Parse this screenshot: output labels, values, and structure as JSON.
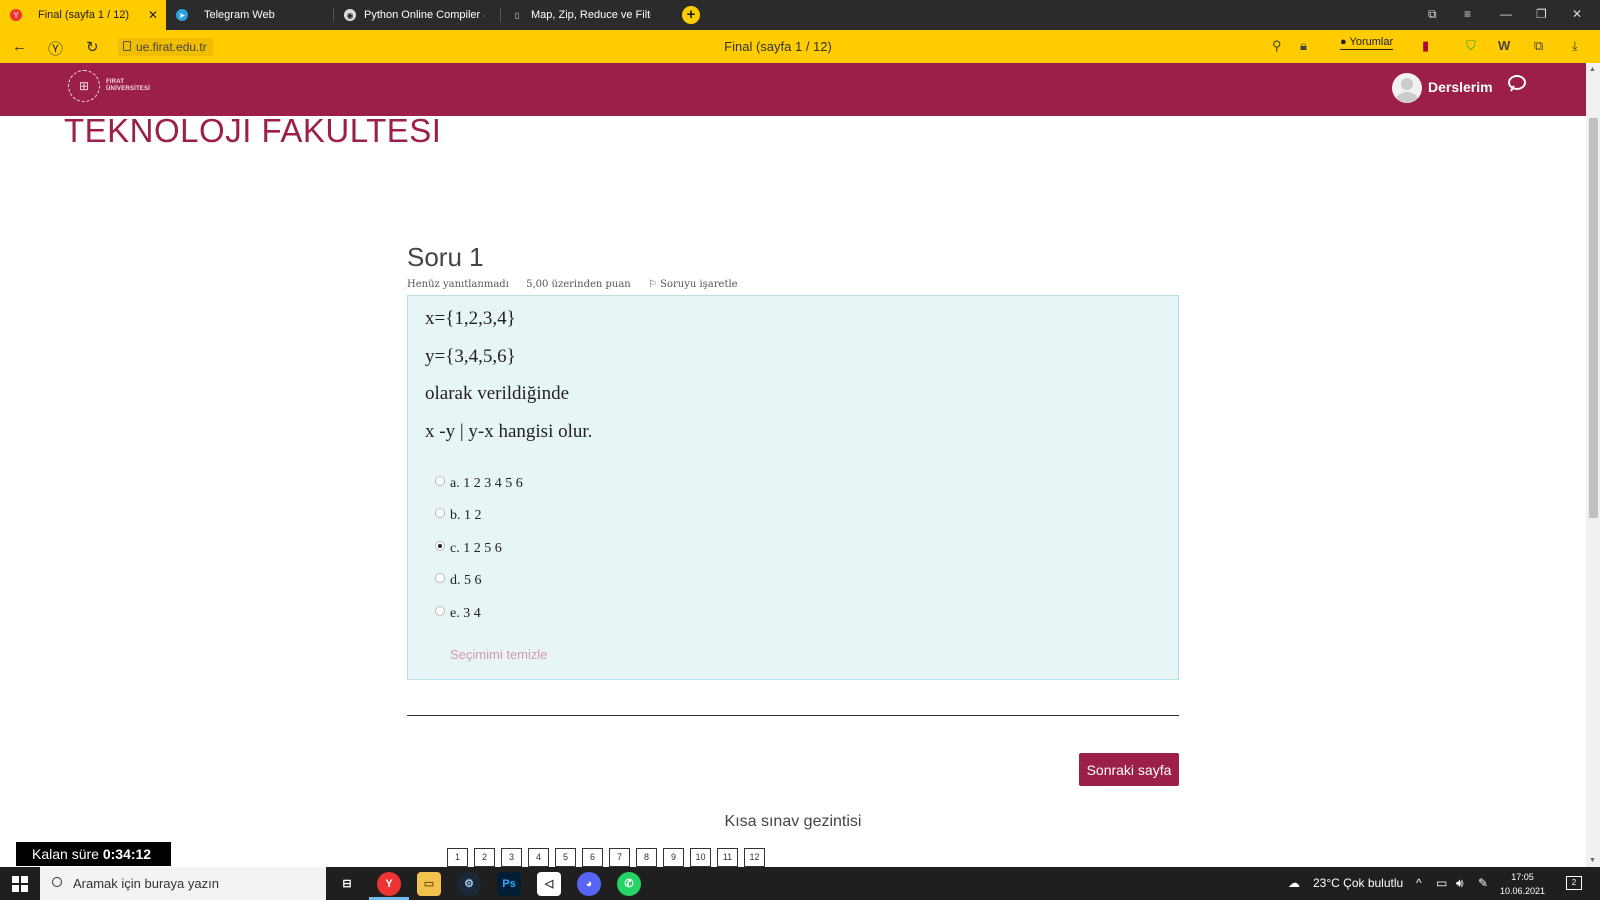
{
  "browser": {
    "tabs": [
      {
        "label": "Final (sayfa 1 / 12)",
        "active": true,
        "icon": "yandex-icon"
      },
      {
        "label": "Telegram Web",
        "active": false,
        "icon": "telegram-icon"
      },
      {
        "label": "Python Online Compiler &",
        "active": false,
        "icon": "compiler-icon"
      },
      {
        "label": "Map, Zip, Reduce ve Filter F",
        "active": false,
        "icon": "document-icon"
      }
    ],
    "url": "ue.firat.edu.tr",
    "page_title": "Final (sayfa 1 / 12)",
    "comments_label": "Yorumlar"
  },
  "site": {
    "logo_line1": "FIRAT",
    "logo_line2": "ÜNİVERSİTESİ",
    "user_menu": "Derslerim",
    "faculty_heading": "TEKNOLOJI FAKULTESI",
    "brand_color": "#9c1f47"
  },
  "question": {
    "title": "Soru 1",
    "status": "Henüz yanıtlanmadı",
    "points": "5,00 üzerinden puan",
    "flag": "Soruyu işaretle",
    "text": [
      "x={1,2,3,4}",
      "y={3,4,5,6}",
      "olarak verildiğinde",
      "x -y | y-x hangisi olur."
    ],
    "options": [
      {
        "label": "a. 1 2 3 4 5 6",
        "checked": false
      },
      {
        "label": "b. 1 2",
        "checked": false
      },
      {
        "label": "c. 1 2 5 6",
        "checked": true
      },
      {
        "label": "d. 5 6",
        "checked": false
      },
      {
        "label": "e. 3 4",
        "checked": false
      }
    ],
    "clear_label": "Seçimimi temizle"
  },
  "navigation": {
    "next_label": "Sonraki sayfa",
    "heading": "Kısa sınav gezintisi",
    "pages": [
      "1",
      "2",
      "3",
      "4",
      "5",
      "6",
      "7",
      "8",
      "9",
      "10",
      "11",
      "12"
    ],
    "current_page": "1"
  },
  "timer": {
    "label": "Kalan süre",
    "value": "0:34:12"
  },
  "taskbar": {
    "search_placeholder": "Aramak için buraya yazın",
    "weather": "23°C  Çok bulutlu",
    "time": "17:05",
    "date": "10.06.2021",
    "notifications": "2"
  }
}
